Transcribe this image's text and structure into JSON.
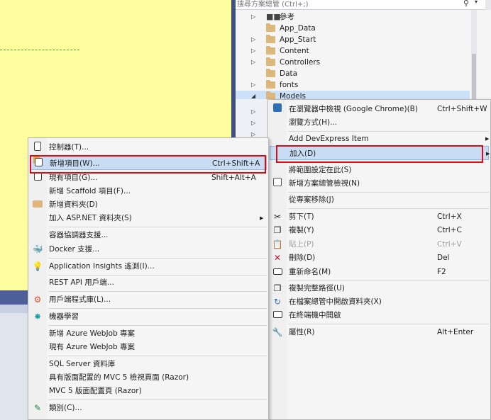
{
  "solution_explorer": {
    "search_placeholder": "搜尋方案總管 (Ctrl+;)",
    "tree": [
      {
        "label": "參考",
        "type": "reference",
        "expanded": false
      },
      {
        "label": "App_Data",
        "type": "folder",
        "expanded": null
      },
      {
        "label": "App_Start",
        "type": "folder",
        "expanded": false
      },
      {
        "label": "Content",
        "type": "folder",
        "expanded": false
      },
      {
        "label": "Controllers",
        "type": "folder",
        "expanded": false
      },
      {
        "label": "Data",
        "type": "folder",
        "expanded": null
      },
      {
        "label": "fonts",
        "type": "folder",
        "expanded": false
      },
      {
        "label": "Models",
        "type": "folder",
        "expanded": true,
        "selected": true
      }
    ]
  },
  "add_submenu": {
    "items": [
      {
        "label": "控制器(T)...",
        "shortcut": "",
        "icon": "controller-icon"
      },
      {
        "label": "新增項目(W)...",
        "shortcut": "Ctrl+Shift+A",
        "icon": "new-item-icon",
        "highlighted": true
      },
      {
        "label": "現有項目(G)...",
        "shortcut": "Shift+Alt+A",
        "icon": "existing-item-icon"
      },
      {
        "label": "新增 Scaffold 項目(F)...",
        "shortcut": "",
        "icon": ""
      },
      {
        "label": "新增資料夾(D)",
        "shortcut": "",
        "icon": "folder-icon"
      },
      {
        "label": "加入 ASP.NET 資料夾(S)",
        "shortcut": "",
        "icon": "",
        "submenu": true
      },
      {
        "label": "容器協調器支援...",
        "shortcut": "",
        "icon": "",
        "separator_before": true
      },
      {
        "label": "Docker 支援...",
        "shortcut": "",
        "icon": "docker-icon"
      },
      {
        "label": "Application Insights 遙測(I)...",
        "shortcut": "",
        "icon": "insights-icon",
        "separator_before": true
      },
      {
        "label": "REST API 用戶端...",
        "shortcut": "",
        "icon": "",
        "separator_before": true
      },
      {
        "label": "用戶端程式庫(L)...",
        "shortcut": "",
        "icon": "library-icon",
        "separator_before": true
      },
      {
        "label": "機器學習",
        "shortcut": "",
        "icon": "ml-icon",
        "separator_before": true
      },
      {
        "label": "新增 Azure WebJob 專案",
        "shortcut": "",
        "icon": "",
        "separator_before": true
      },
      {
        "label": "現有 Azure WebJob 專案",
        "shortcut": "",
        "icon": ""
      },
      {
        "label": "SQL Server 資料庫",
        "shortcut": "",
        "icon": "",
        "separator_before": true
      },
      {
        "label": "具有版面配置的 MVC 5 檢視頁面 (Razor)",
        "shortcut": "",
        "icon": ""
      },
      {
        "label": "MVC 5 版面配置頁 (Razor)",
        "shortcut": "",
        "icon": ""
      },
      {
        "label": "類別(C)...",
        "shortcut": "",
        "icon": "class-icon",
        "separator_before": true
      }
    ]
  },
  "context_menu": {
    "items": [
      {
        "label": "在瀏覽器中檢視 (Google Chrome)(B)",
        "shortcut": "Ctrl+Shift+W",
        "icon": "browser-icon"
      },
      {
        "label": "瀏覽方式(H)...",
        "shortcut": "",
        "icon": ""
      },
      {
        "label": "Add DevExpress Item",
        "shortcut": "",
        "icon": "",
        "submenu": true,
        "separator_before": true
      },
      {
        "label": "加入(D)",
        "shortcut": "",
        "icon": "",
        "submenu": true,
        "highlighted": true
      },
      {
        "label": "將範圍設定在此(S)",
        "shortcut": "",
        "icon": ""
      },
      {
        "label": "新增方案總管檢視(N)",
        "shortcut": "",
        "icon": "new-view-icon"
      },
      {
        "label": "從專案移除(J)",
        "shortcut": "",
        "icon": "",
        "separator_before": true
      },
      {
        "label": "剪下(T)",
        "shortcut": "Ctrl+X",
        "icon": "cut-icon",
        "separator_before": true
      },
      {
        "label": "複製(Y)",
        "shortcut": "Ctrl+C",
        "icon": "copy-icon"
      },
      {
        "label": "貼上(P)",
        "shortcut": "Ctrl+V",
        "icon": "paste-icon",
        "disabled": true
      },
      {
        "label": "刪除(D)",
        "shortcut": "Del",
        "icon": "delete-icon"
      },
      {
        "label": "重新命名(M)",
        "shortcut": "F2",
        "icon": "rename-icon"
      },
      {
        "label": "複製完整路徑(U)",
        "shortcut": "",
        "icon": "copy-path-icon",
        "separator_before": true
      },
      {
        "label": "在檔案總管中開啟資料夾(X)",
        "shortcut": "",
        "icon": "open-folder-icon"
      },
      {
        "label": "在終端機中開啟",
        "shortcut": "",
        "icon": "terminal-icon"
      },
      {
        "label": "屬性(R)",
        "shortcut": "Alt+Enter",
        "icon": "properties-icon",
        "separator_before": true
      }
    ]
  },
  "colors": {
    "editor_bg": "#ffff9f",
    "highlight_border": "#e00b12",
    "menu_highlight": "#c9def5"
  }
}
